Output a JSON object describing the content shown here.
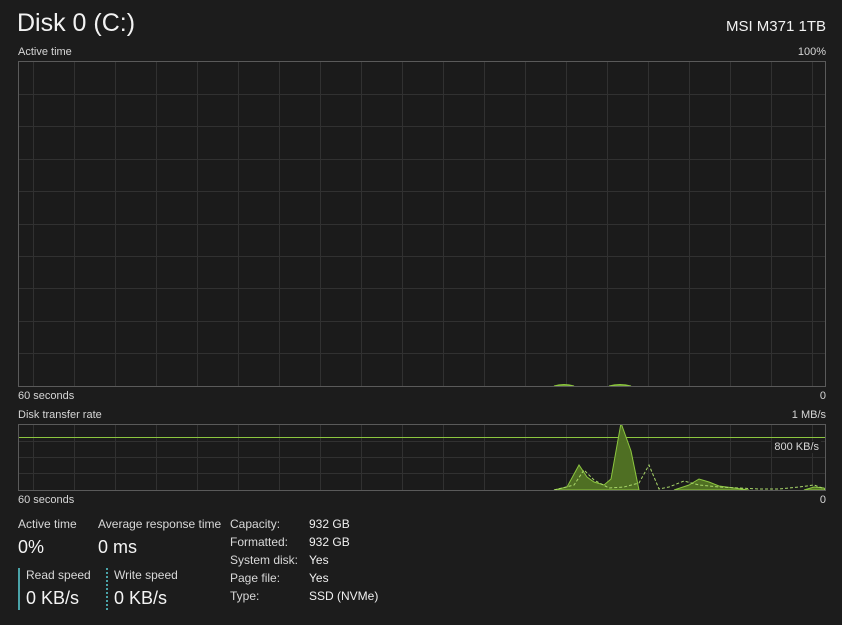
{
  "header": {
    "title": "Disk 0 (C:)",
    "model": "MSI M371 1TB"
  },
  "active_graph": {
    "label": "Active time",
    "max_label": "100%",
    "time_label": "60 seconds",
    "min_label": "0"
  },
  "transfer_graph": {
    "label": "Disk transfer rate",
    "max_label": "1 MB/s",
    "ref_label": "800 KB/s",
    "time_label": "60 seconds",
    "min_label": "0"
  },
  "stats": {
    "active_time_label": "Active time",
    "active_time_value": "0%",
    "response_label": "Average response time",
    "response_value": "0 ms",
    "read_label": "Read speed",
    "read_value": "0 KB/s",
    "write_label": "Write speed",
    "write_value": "0 KB/s"
  },
  "properties": [
    {
      "label": "Capacity:",
      "value": "932 GB"
    },
    {
      "label": "Formatted:",
      "value": "932 GB"
    },
    {
      "label": "System disk:",
      "value": "Yes"
    },
    {
      "label": "Page file:",
      "value": "Yes"
    },
    {
      "label": "Type:",
      "value": "SSD (NVMe)"
    }
  ],
  "colors": {
    "accent": "#8cc63f",
    "read_bar": "#4aa3a8",
    "grid": "#333333"
  }
}
